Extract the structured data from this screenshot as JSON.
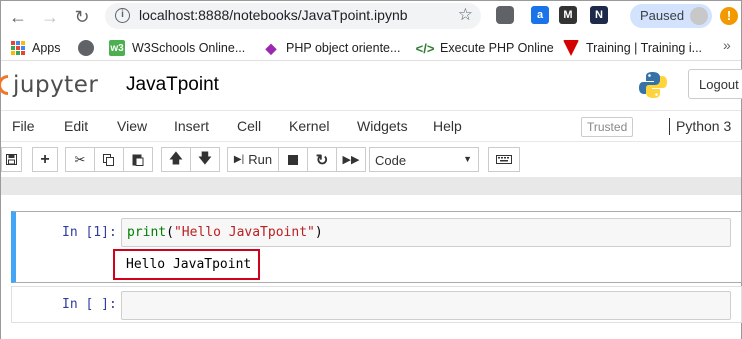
{
  "browser": {
    "url": "localhost:8888/notebooks/JavaTpoint.ipynb",
    "profile_status": "Paused"
  },
  "bookmarks": [
    {
      "label": "Apps"
    },
    {
      "label": ""
    },
    {
      "label": "W3Schools Online..."
    },
    {
      "label": "PHP object oriente..."
    },
    {
      "label": "Execute PHP Online"
    },
    {
      "label": "Training | Training i..."
    }
  ],
  "jupyter": {
    "logo_text": "jupyter",
    "notebook_name": "JavaTpoint",
    "logout_label": "Logout"
  },
  "menu": {
    "items": [
      "File",
      "Edit",
      "View",
      "Insert",
      "Cell",
      "Kernel",
      "Widgets",
      "Help"
    ],
    "trusted_label": "Trusted",
    "kernel_name": "Python 3"
  },
  "toolbar": {
    "run_label": "Run",
    "cell_type": "Code"
  },
  "cells": [
    {
      "prompt": "In [1]:",
      "code_fn": "print",
      "code_open": "(",
      "code_str": "\"Hello JavaTpoint\"",
      "code_close": ")",
      "output": "Hello JavaTpoint"
    },
    {
      "prompt": "In [ ]:",
      "code": ""
    }
  ],
  "colors": {
    "accent_blue": "#42a5f5",
    "jupyter_orange": "#f37626",
    "highlight_red": "#d0021b"
  }
}
